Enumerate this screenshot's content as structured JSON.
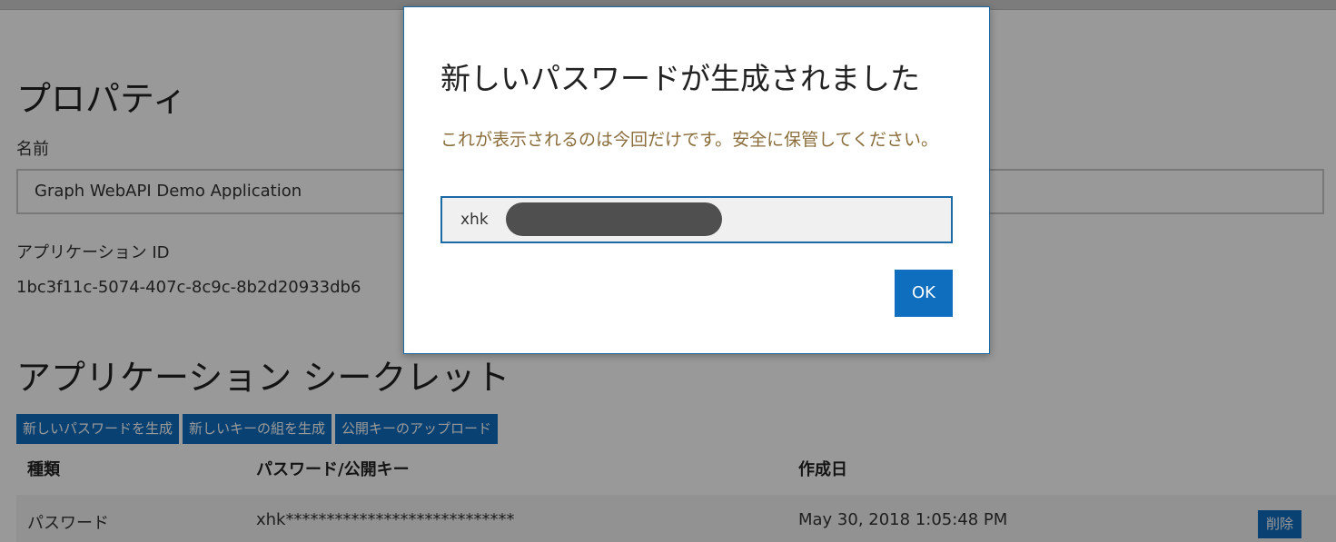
{
  "properties": {
    "heading": "プロパティ",
    "name_label": "名前",
    "name_value": "Graph WebAPI Demo Application",
    "app_id_label": "アプリケーション ID",
    "app_id_value": "1bc3f11c-5074-407c-8c9c-8b2d20933db6"
  },
  "secrets": {
    "heading": "アプリケーション シークレット",
    "buttons": [
      "新しいパスワードを生成",
      "新しいキーの組を生成",
      "公開キーのアップロード"
    ],
    "columns": [
      "種類",
      "パスワード/公開キー",
      "作成日"
    ],
    "rows": [
      {
        "type": "パスワード",
        "value": "xhk****************************",
        "created": "May 30, 2018 1:05:48 PM",
        "action": "削除"
      }
    ]
  },
  "dialog": {
    "title": "新しいパスワードが生成されました",
    "warning": "これが表示されるのは今回だけです。安全に保管してください。",
    "password_visible": "xhk",
    "ok_label": "OK"
  },
  "colors": {
    "accent": "#106ebe",
    "warning_text": "#8a6d3b"
  }
}
